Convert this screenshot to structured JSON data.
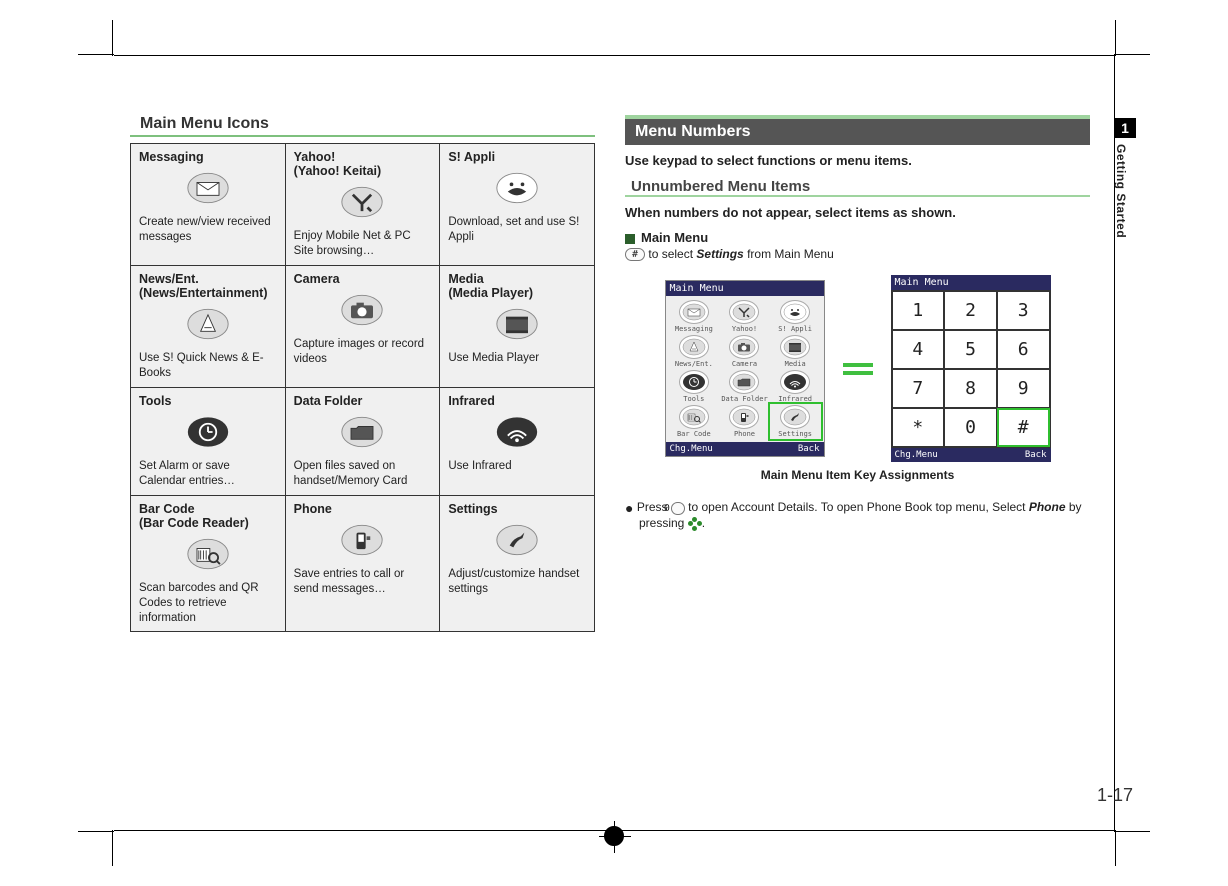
{
  "sidetab": {
    "chapter": "1",
    "label": "Getting Started"
  },
  "pageNumber": "1-17",
  "left": {
    "heading": "Main Menu Icons",
    "grid": [
      [
        {
          "title": "Messaging",
          "desc": "Create new/view received messages"
        },
        {
          "title": "Yahoo!\n(Yahoo! Keitai)",
          "desc": "Enjoy Mobile Net & PC Site browsing…"
        },
        {
          "title": "S! Appli",
          "desc": "Download, set and use S! Appli"
        }
      ],
      [
        {
          "title": "News/Ent.\n(News/Entertainment)",
          "desc": "Use S! Quick News & E-Books"
        },
        {
          "title": "Camera",
          "desc": "Capture images or record videos"
        },
        {
          "title": "Media\n(Media Player)",
          "desc": "Use Media Player"
        }
      ],
      [
        {
          "title": "Tools",
          "desc": "Set Alarm or save Calendar entries…"
        },
        {
          "title": "Data Folder",
          "desc": "Open files saved on handset/Memory Card"
        },
        {
          "title": "Infrared",
          "desc": "Use Infrared"
        }
      ],
      [
        {
          "title": "Bar Code\n(Bar Code Reader)",
          "desc": "Scan barcodes and QR Codes to retrieve information"
        },
        {
          "title": "Phone",
          "desc": "Save entries to call or send messages…"
        },
        {
          "title": "Settings",
          "desc": "Adjust/customize handset settings"
        }
      ]
    ]
  },
  "right": {
    "heading": "Menu Numbers",
    "intro": "Use keypad to select functions or menu items.",
    "subheading": "Unnumbered Menu Items",
    "subintro": "When numbers do not appear, select items as shown.",
    "mainMenuLabel": "Main Menu",
    "hashKey": "#",
    "note_before": " to select ",
    "note_settings": "Settings",
    "note_after": " from Main Menu",
    "screen": {
      "title": "Main Menu",
      "items": [
        "Messaging",
        "Yahoo!",
        "S! Appli",
        "News/Ent.",
        "Camera",
        "Media",
        "Tools",
        "Data Folder",
        "Infrared",
        "Bar Code",
        "Phone",
        "Settings"
      ],
      "footer_left": "Chg.Menu",
      "footer_right": "Back",
      "highlight": "Settings"
    },
    "keypad": {
      "title": "Main Menu",
      "keys": [
        "1",
        "2",
        "3",
        "4",
        "5",
        "6",
        "7",
        "8",
        "9",
        "*",
        "0",
        "#"
      ],
      "highlight": "#",
      "footer_left": "Chg.Menu",
      "footer_right": "Back"
    },
    "caption": "Main Menu Item Key Assignments",
    "bullet_press": "Press ",
    "bullet_key": "0",
    "bullet_mid": " to open Account Details. To open Phone Book top menu, Select ",
    "bullet_phone": "Phone",
    "bullet_end": " by pressing  ",
    "bullet_period": "."
  }
}
